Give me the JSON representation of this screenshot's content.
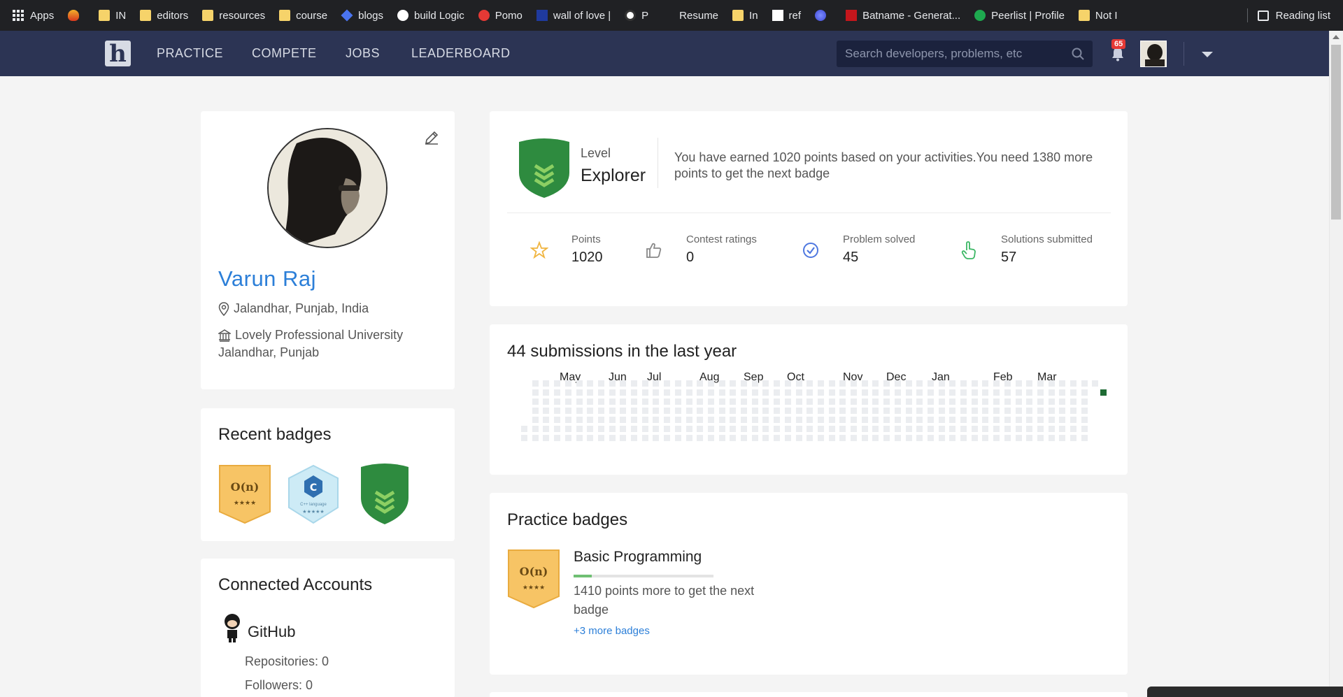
{
  "browser": {
    "apps_label": "Apps",
    "bookmarks": [
      {
        "label": "",
        "icon": "flame-icon"
      },
      {
        "label": "IN",
        "icon": "folder-icon"
      },
      {
        "label": "editors",
        "icon": "folder-icon"
      },
      {
        "label": "resources",
        "icon": "folder-icon"
      },
      {
        "label": "course",
        "icon": "folder-icon"
      },
      {
        "label": "blogs",
        "icon": "diamond-icon"
      },
      {
        "label": "build Logic",
        "icon": "github-icon"
      },
      {
        "label": "Pomo",
        "icon": "check-circle-icon"
      },
      {
        "label": "wall of love |",
        "icon": "neo-icon"
      },
      {
        "label": "P",
        "icon": "globe-icon"
      },
      {
        "label": "Resume",
        "icon": "paypal-p-icon"
      },
      {
        "label": "In",
        "icon": "folder-icon"
      },
      {
        "label": "ref",
        "icon": "hackerearth-icon"
      },
      {
        "label": "",
        "icon": "spark-icon"
      },
      {
        "label": "Batname - Generat...",
        "icon": "ok-icon"
      },
      {
        "label": "Peerlist | Profile",
        "icon": "peerlist-icon"
      },
      {
        "label": "Not I",
        "icon": "folder-icon"
      }
    ],
    "reading_list": "Reading list"
  },
  "nav": {
    "logo": "h",
    "links": [
      "PRACTICE",
      "COMPETE",
      "JOBS",
      "LEADERBOARD"
    ],
    "search_placeholder": "Search developers, problems, etc",
    "notification_count": "65"
  },
  "profile": {
    "name": "Varun Raj",
    "location": "Jalandhar, Punjab, India",
    "university_line1": "Lovely Professional University",
    "university_line2": "Jalandhar, Punjab"
  },
  "recent_badges": {
    "title": "Recent badges",
    "badges": [
      {
        "text": "O(n)",
        "stars": "★★★★",
        "color": "#f7c465"
      },
      {
        "text": "C",
        "sub": "C++ language",
        "stars": "★★★★★",
        "color": "#cdebf6"
      },
      {
        "text": "",
        "color": "#2e8b3f"
      }
    ]
  },
  "connected": {
    "title": "Connected Accounts",
    "github_label": "GitHub",
    "repositories": "Repositories: 0",
    "followers": "Followers: 0"
  },
  "level": {
    "label": "Level",
    "value": "Explorer",
    "description": "You have earned 1020 points based on your activities.You need 1380 more points to get the next badge",
    "stats": [
      {
        "label": "Points",
        "value": "1020",
        "icon": "star-icon",
        "bg": "#fff3d9",
        "fg": "#f0b541"
      },
      {
        "label": "Contest ratings",
        "value": "0",
        "icon": "thumbs-up-icon",
        "bg": "#e6e6e6",
        "fg": "#888888"
      },
      {
        "label": "Problem solved",
        "value": "45",
        "icon": "check-badge-icon",
        "bg": "#e3e9fb",
        "fg": "#4f78e0"
      },
      {
        "label": "Solutions submitted",
        "value": "57",
        "icon": "pointer-hand-icon",
        "bg": "#e4f6ea",
        "fg": "#3cb765"
      }
    ]
  },
  "submissions": {
    "title": "44 submissions in the last year",
    "months": [
      "May",
      "Jun",
      "Jul",
      "Aug",
      "Sep",
      "Oct",
      "Nov",
      "Dec",
      "Jan",
      "Feb",
      "Mar"
    ],
    "empty_color": "#ebedf0",
    "active_color": "#1e6b34"
  },
  "practice": {
    "title": "Practice badges",
    "badge_text": "O(n)",
    "badge_stars": "★★★★",
    "category": "Basic Programming",
    "progress_fraction": 0.13,
    "next": "1410 points more to get the next badge",
    "more_link": "+3 more badges"
  }
}
